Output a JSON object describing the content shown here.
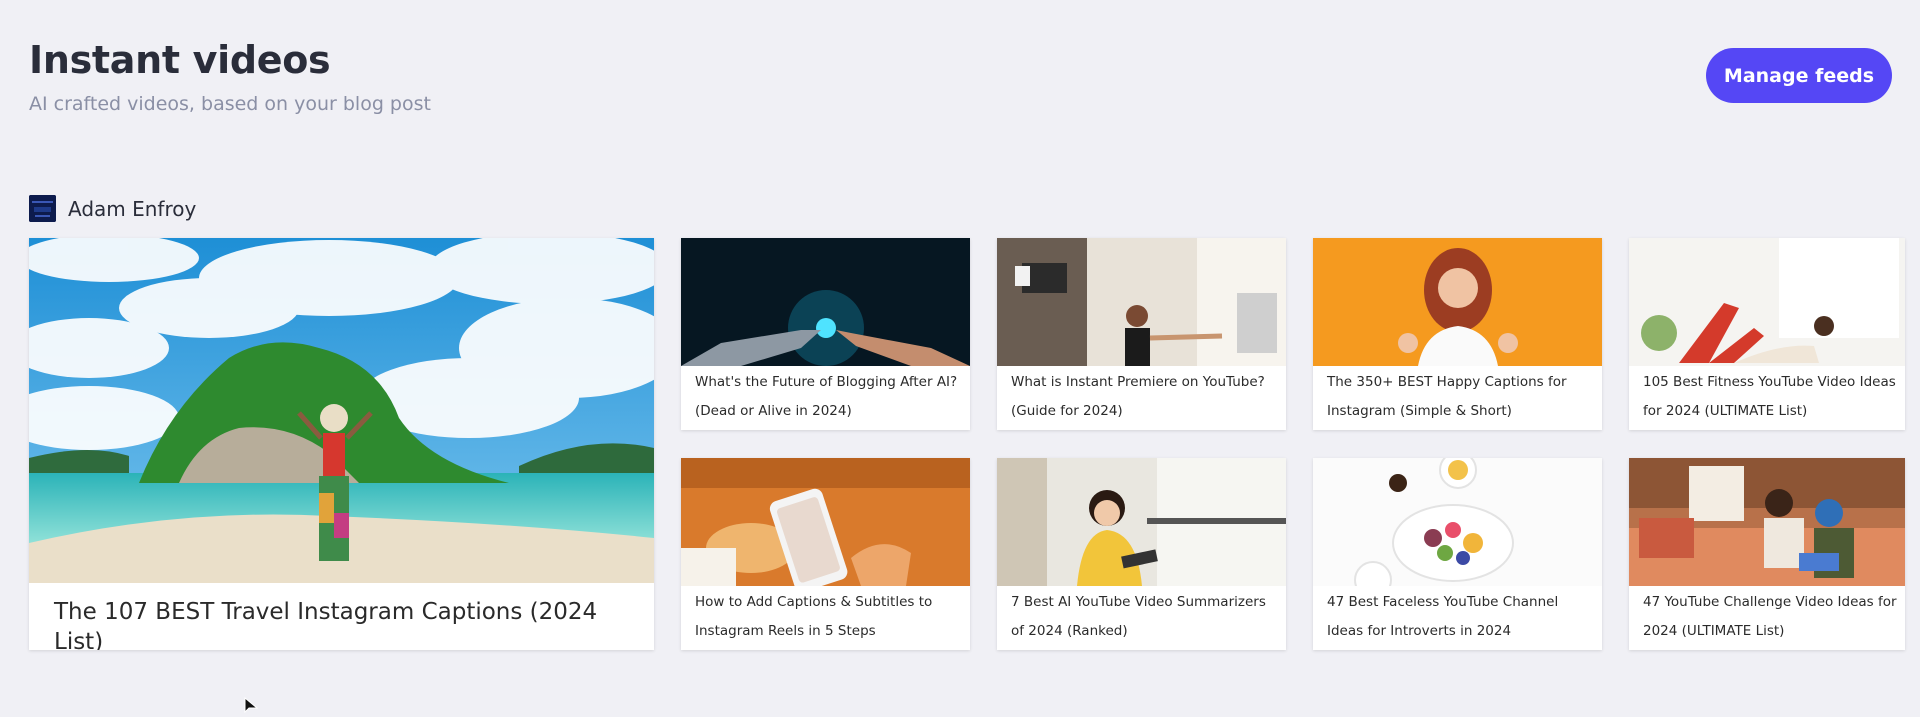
{
  "header": {
    "title": "Instant videos",
    "subtitle": "AI crafted videos, based on your blog post",
    "manage_feeds_label": "Manage feeds"
  },
  "feed": {
    "name": "Adam Enfroy",
    "avatar_icon": "site-logo-icon",
    "featured": {
      "title": "The 107 BEST Travel Instagram Captions (2024 List)",
      "thumbnail": "travel-beach-island-image"
    },
    "items": [
      {
        "title_line1": "What's the Future of Blogging After AI?",
        "title_line2": "(Dead or Alive in 2024)",
        "thumbnail": "robot-hand-touching-human-hand-image"
      },
      {
        "title_line1": "What is Instant Premiere on YouTube?",
        "title_line2": "(Guide for 2024)",
        "thumbnail": "creator-filming-camera-image"
      },
      {
        "title_line1": "The 350+ BEST Happy Captions for",
        "title_line2": "Instagram (Simple & Short)",
        "thumbnail": "excited-woman-orange-background-image"
      },
      {
        "title_line1": "105 Best Fitness YouTube Video Ideas",
        "title_line2": "for 2024 (ULTIMATE List)",
        "thumbnail": "woman-doing-crunches-image"
      },
      {
        "title_line1": "How to Add Captions & Subtitles to",
        "title_line2": "Instagram Reels in 5 Steps",
        "thumbnail": "phone-on-orange-desk-image"
      },
      {
        "title_line1": "7 Best AI YouTube Video Summarizers",
        "title_line2": "of 2024 (Ranked)",
        "thumbnail": "woman-using-tablet-image"
      },
      {
        "title_line1": "47 Best Faceless YouTube Channel",
        "title_line2": "Ideas for Introverts in 2024",
        "thumbnail": "food-plates-top-view-image"
      },
      {
        "title_line1": "47 YouTube Challenge Video Ideas for",
        "title_line2": "2024 (ULTIMATE List)",
        "thumbnail": "friends-laughing-couch-image"
      }
    ]
  },
  "colors": {
    "background": "#f0f0f5",
    "accent": "#5547f5",
    "title_text": "#2a2d3a",
    "subtitle_text": "#8a8fa5"
  }
}
